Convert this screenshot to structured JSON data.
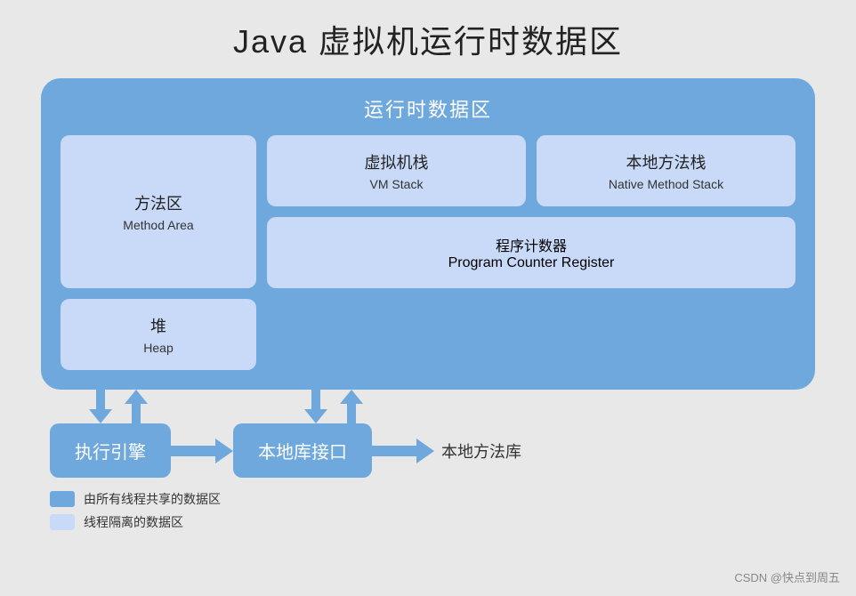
{
  "title": "Java 虚拟机运行时数据区",
  "runtime_section": {
    "label": "运行时数据区",
    "cells": [
      {
        "id": "method-area",
        "zh": "方法区",
        "en": "Method Area"
      },
      {
        "id": "vm-stack",
        "zh": "虚拟机栈",
        "en": "VM Stack"
      },
      {
        "id": "native-method-stack",
        "zh": "本地方法栈",
        "en": "Native Method Stack"
      },
      {
        "id": "heap",
        "zh": "堆",
        "en": "Heap"
      },
      {
        "id": "program-counter",
        "zh": "程序计数器",
        "en": "Program Counter Register"
      }
    ]
  },
  "bottom": {
    "execute_engine": "执行引擎",
    "native_interface": "本地库接口",
    "native_lib": "本地方法库"
  },
  "legend": [
    {
      "color": "dark",
      "text": "由所有线程共享的数据区"
    },
    {
      "color": "light",
      "text": "线程隔离的数据区"
    }
  ],
  "watermark": "CSDN @快点到周五"
}
